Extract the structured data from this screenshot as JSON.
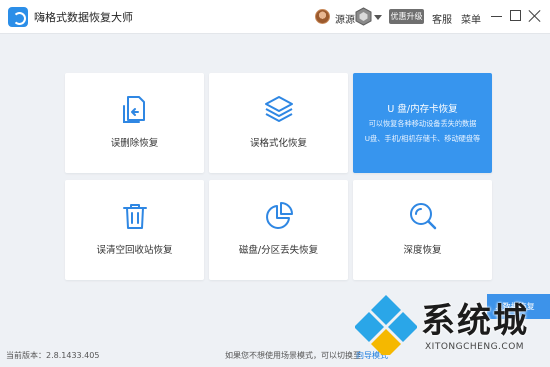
{
  "app": {
    "title": "嗨格式数据恢复大师"
  },
  "header": {
    "username": "源源",
    "upgrade_label": "优惠升级",
    "service_label": "客服",
    "menu_label": "菜单"
  },
  "cards": [
    {
      "label": "误删除恢复",
      "icon": "file-restore-icon"
    },
    {
      "label": "误格式化恢复",
      "icon": "layers-icon"
    },
    {
      "label": "U 盘/内存卡恢复",
      "icon": "usb-drive-icon",
      "desc1": "可以恢复各种移动设备丢失的数据",
      "desc2": "U盘、手机/相机存储卡、移动硬盘等"
    },
    {
      "label": "误清空回收站恢复",
      "icon": "trash-icon"
    },
    {
      "label": "磁盘/分区丢失恢复",
      "icon": "pie-chart-icon"
    },
    {
      "label": "深度恢复",
      "icon": "magnifier-icon"
    }
  ],
  "partial_button": {
    "label": "...数据恢复"
  },
  "footer": {
    "version_label": "当前版本：2.8.1433.405",
    "switch_hint": "如果您不想使用场景模式，可以切换至",
    "guide_link": "向导模式"
  },
  "watermark": {
    "text": "系统城",
    "domain": "XITONGCHENG.COM"
  },
  "colors": {
    "accent": "#3795ee",
    "link": "#1f7ee0",
    "background": "#eef1f5"
  }
}
